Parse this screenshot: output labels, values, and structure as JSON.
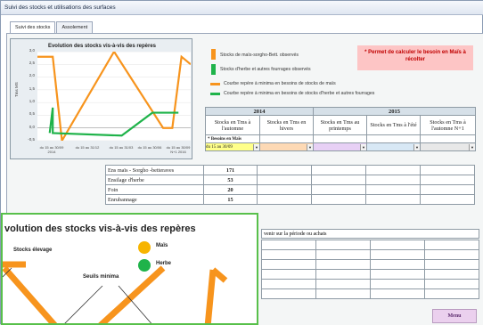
{
  "window": {
    "title": "Suivi des stocks et utilisations des surfaces"
  },
  "tabs": [
    {
      "label": "Suivi des stocks"
    },
    {
      "label": "Assolement"
    }
  ],
  "small_chart": {
    "title": "Evolution des stocks vis-à-vis des repères",
    "ylabel": "Tms MS",
    "yticks": [
      "3,0",
      "2,5",
      "2,0",
      "1,5",
      "1,0",
      "0,5",
      "0,0",
      "-0,5"
    ],
    "xticks": [
      "du 15 au 30/09 2014",
      "du 15 au 31/12",
      "du 15 au 31/03",
      "du 15 au 30/06",
      "du 15 au 30/09 N+1 2016"
    ],
    "colors": {
      "orange": "#f7941d",
      "green": "#1fb34a"
    }
  },
  "chart_data": [
    {
      "type": "line",
      "title": "Evolution des stocks vis-à-vis des repères",
      "ylabel": "Tms MS",
      "ylim": [
        -0.5,
        3.0
      ],
      "series": [
        {
          "color": "#f7941d",
          "points": [
            [
              0,
              2.8
            ],
            [
              0.1,
              2.8
            ],
            [
              0.16,
              -0.5
            ],
            [
              0.5,
              3.0
            ],
            [
              0.82,
              0.0
            ],
            [
              0.88,
              0.0
            ],
            [
              0.94,
              2.8
            ],
            [
              1.0,
              2.5
            ]
          ]
        },
        {
          "color": "#1fb34a",
          "points": [
            [
              0.08,
              -0.2
            ],
            [
              0.1,
              0.8
            ],
            [
              0.1,
              -0.2
            ],
            [
              0.55,
              -0.3
            ],
            [
              0.75,
              0.6
            ],
            [
              0.92,
              0.6
            ]
          ]
        }
      ]
    },
    {
      "type": "line",
      "title": "Evolution des stocks vis-à-vis des repères",
      "series": [
        {
          "name": "Maïs",
          "color": "#f7b400"
        },
        {
          "name": "Herbe",
          "color": "#1fb34a"
        }
      ]
    }
  ],
  "legend": [
    {
      "text": "Stocks de maïs-sorgho-Bett. observés",
      "color": "#f7941d",
      "kind": "bar"
    },
    {
      "text": "Stocks d'herbe et autres fourrages observés",
      "color": "#1fb34a",
      "kind": "bar"
    },
    {
      "text": "Courbe repère à minima en besoins de stocks de maïs",
      "color": "#f7941d",
      "kind": "line"
    },
    {
      "text": "Courbe repère à minima en besoins de stocks d'herbe et autres fourrages",
      "color": "#1fb34a",
      "kind": "line"
    }
  ],
  "note": "* Permet de calculer le besoin en Maïs à récolter",
  "table": {
    "years": [
      "2014",
      "2015"
    ],
    "headers": [
      "Stocks en Tms à l'automne",
      "Stocks en Tms en hivers",
      "Stocks en Tms au printemps",
      "Stocks en Tms à l'été",
      "Stocks en Tms à l'automne N+1"
    ],
    "besoin_label": "* Besoins en Maïs",
    "selected_period": "du 15 au 30/09"
  },
  "rows": [
    {
      "label": "Ens maïs - Sorgho -betteraves",
      "value": "171"
    },
    {
      "label": "Ensilage d'herbe",
      "value": "53"
    },
    {
      "label": "Foin",
      "value": "20"
    },
    {
      "label": "Enrubannage",
      "value": "15"
    }
  ],
  "lower_section": {
    "label": "venir sur la période ou achats"
  },
  "menu_button": "Menu",
  "big_chart": {
    "title": "volution des stocks vis-à-vis des repères",
    "labels": {
      "stocks": "Stocks élevage",
      "seuils": "Seuils minima",
      "mais": "Maïs",
      "herbe": "Herbe"
    },
    "colors": {
      "mais": "#f7b400",
      "herbe": "#1fb34a",
      "line": "#f7941d"
    }
  }
}
